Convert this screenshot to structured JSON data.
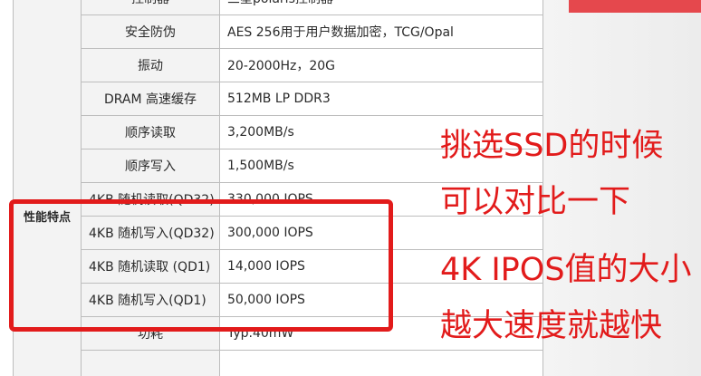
{
  "table": {
    "rows": [
      {
        "name": "控制器",
        "value": "三星polaris控制器"
      },
      {
        "name": "安全防伪",
        "value": "AES 256用于用户数据加密，TCG/Opal"
      },
      {
        "name": "振动",
        "value": "20-2000Hz，20G"
      },
      {
        "name": "DRAM 高速缓存",
        "value": "512MB LP DDR3"
      },
      {
        "name": "顺序读取",
        "value": "3,200MB/s"
      },
      {
        "name": "顺序写入",
        "value": "1,500MB/s"
      },
      {
        "name": "4KB 随机读取(QD32)",
        "value": "330,000 IOPS"
      },
      {
        "name": "4KB 随机写入(QD32)",
        "value": "300,000 IOPS"
      },
      {
        "name": "4KB 随机读取 (QD1)",
        "value": "14,000 IOPS"
      },
      {
        "name": "4KB 随机写入(QD1)",
        "value": "50,000 IOPS"
      },
      {
        "name": "功耗",
        "value": "Typ.40mW"
      },
      {
        "name": "",
        "value": ""
      }
    ],
    "category_label": "性能特点"
  },
  "annotation": {
    "lines": [
      "挑选SSD的时候",
      "可以对比一下",
      "4K IPOS值的大小",
      "越大速度就越快"
    ],
    "color": "#e21b1b"
  },
  "colors": {
    "highlight": "#e21b1b",
    "accent_bar": "#e5484d"
  }
}
